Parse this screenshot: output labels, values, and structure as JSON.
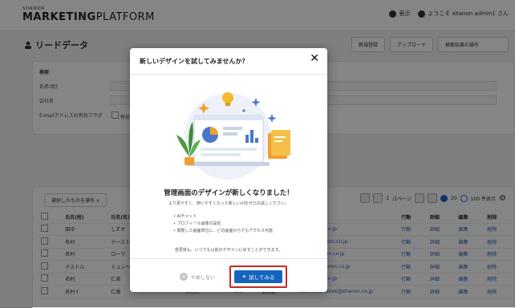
{
  "brand": {
    "small": "SHANON",
    "bold": "MARKETING",
    "light": "PLATFORM"
  },
  "topbar": {
    "help": "表示",
    "user": "ようこそ shanon admin1 さん"
  },
  "page": {
    "title": "リードデータ"
  },
  "subbar": {
    "btn_new": "新規登録",
    "btn_upload": "アップロード",
    "btn_bulk": "検索結果の操作"
  },
  "search_panel": {
    "section": "検索",
    "field1": "氏名(姓)",
    "field2": "会社名",
    "email_flag": "E-mailアドレスの有効フラグ",
    "email_opt": "有効"
  },
  "list": {
    "bulk_dropdown": "選択したものを操作 ∨",
    "pager_page": "1",
    "pager_text": "/1ページ",
    "per_page_20": "20",
    "per_page_100": "100 件表示",
    "columns": [
      "",
      "氏名(姓)",
      "氏名(名)",
      "",
      "",
      "",
      "",
      "",
      "",
      "行動",
      "詳細",
      "編集",
      "削除"
    ],
    "rows": [
      [
        "",
        "田中",
        "しずオ",
        "",
        "",
        "",
        "",
        "",
        "",
        "行動",
        "詳細",
        "編集",
        "削除"
      ],
      [
        "",
        "名村",
        "テーストリア",
        "",
        "",
        "",
        "",
        "",
        "",
        "行動",
        "詳細",
        "編集",
        "削除"
      ],
      [
        "",
        "名村",
        "ローマ",
        "",
        "",
        "",
        "",
        "",
        "",
        "行動",
        "詳細",
        "編集",
        "削除"
      ],
      [
        "",
        "テストル",
        "ミュンヘン",
        "",
        "",
        "",
        "",
        "",
        "",
        "行動",
        "詳細",
        "編集",
        "削除"
      ],
      [
        "",
        "名村",
        "仁美",
        "",
        "",
        "",
        "",
        "",
        "",
        "行動",
        "詳細",
        "編集",
        "削除"
      ],
      [
        "",
        "名村イ",
        "仁美",
        "",
        "名村仁",
        "",
        "101",
        "東京都",
        "tatamura.hitomi@shanon.co.jp",
        "行動",
        "詳細",
        "編集",
        "削除"
      ]
    ],
    "emails": [
      "o@shanon.co.jp",
      "ustria@shanon.co.jp",
      "ome@shanon.co.jp",
      "nunich@shanon.co.jp",
      "o@shanon.co.jp"
    ]
  },
  "modal": {
    "title": "新しいデザインを試してみませんか？",
    "close": "✕",
    "heading": "管理画面のデザインが新しくなりました！",
    "desc": "より見やすく、使いやすくなった新しいUIをぜひお試しください。",
    "bullets": [
      "• AIチャット",
      "• プロフィール画像の設定",
      "• 閲覧した画面単位に、どの画面からでもアクセス可能"
    ],
    "note": "変更後も、いつでも以前のデザインに戻すことができます。",
    "later_label": "やめしない",
    "try_label": "試してみる"
  },
  "colors": {
    "primary": "#1565c0",
    "highlight": "#c62828"
  }
}
